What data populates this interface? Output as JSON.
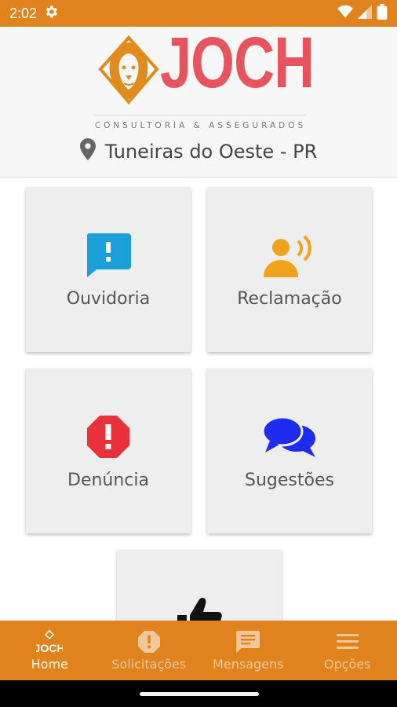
{
  "status_bar": {
    "time": "2:02"
  },
  "header": {
    "logo_word": "JOCH",
    "logo_subtitle": "CONSULTORIA & ASSEGURADOS",
    "location": "Tuneiras do Oeste - PR"
  },
  "tiles": [
    {
      "label": "Ouvidoria",
      "icon": "ouvidoria-feedback-icon",
      "color": "#1a9fd9"
    },
    {
      "label": "Reclamação",
      "icon": "person-speaking-icon",
      "color": "#f0a21a"
    },
    {
      "label": "Denúncia",
      "icon": "alert-octagon-icon",
      "color": "#e8313a"
    },
    {
      "label": "Sugestões",
      "icon": "chat-bubbles-icon",
      "color": "#1f2cf0"
    },
    {
      "label": "",
      "icon": "thumbs-up-icon",
      "color": "#111111"
    }
  ],
  "bottom_nav": [
    {
      "label": "Home",
      "icon": "joch-logo-icon",
      "active": true
    },
    {
      "label": "Solicitações",
      "icon": "alert-octagon-icon",
      "active": false
    },
    {
      "label": "Mensagens",
      "icon": "message-icon",
      "active": false
    },
    {
      "label": "Opções",
      "icon": "menu-icon",
      "active": false
    }
  ],
  "colors": {
    "accent": "#e0821e",
    "logo_red": "#e8545e",
    "logo_orange": "#e08b1e"
  }
}
